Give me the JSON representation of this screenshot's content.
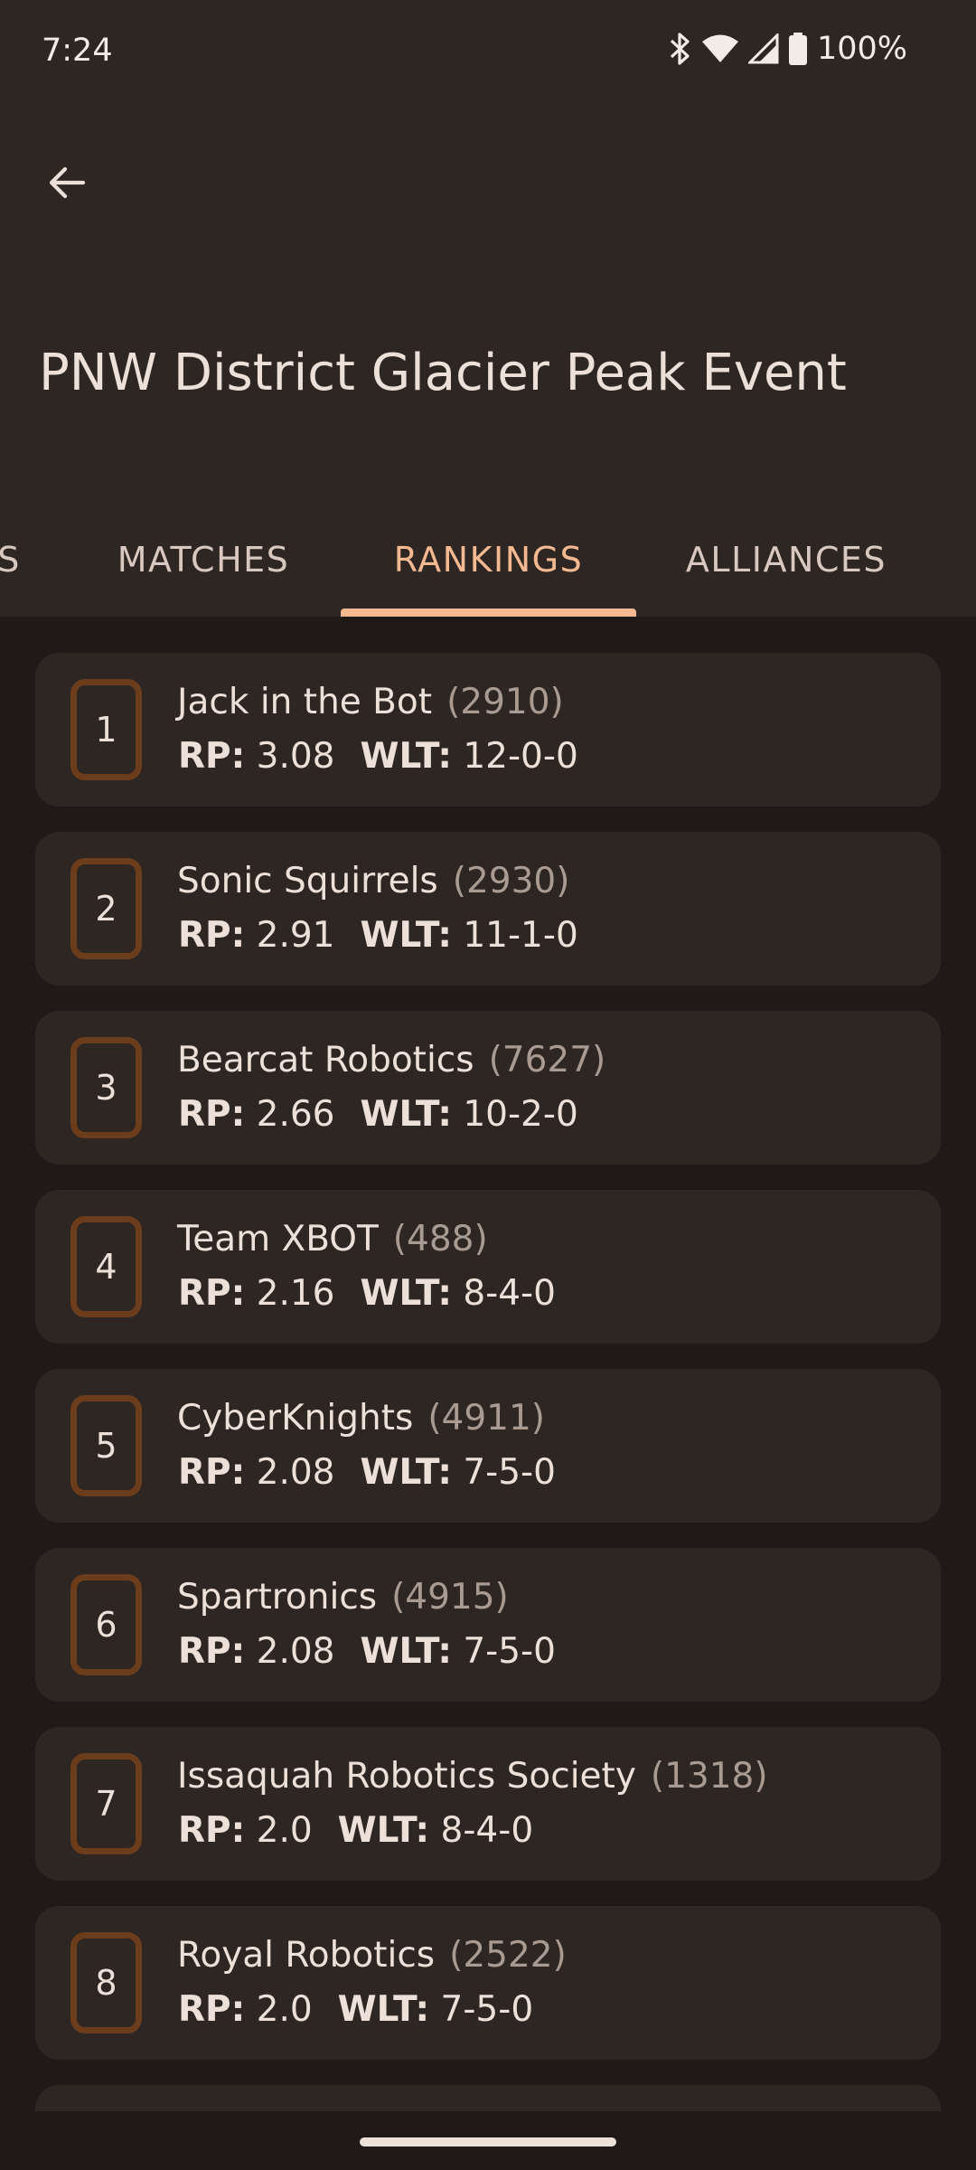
{
  "status_bar": {
    "time": "7:24",
    "battery": "100%"
  },
  "header": {
    "title": "PNW District Glacier Peak Event"
  },
  "tabs": [
    {
      "label": "S",
      "active": false
    },
    {
      "label": "MATCHES",
      "active": false
    },
    {
      "label": "RANKINGS",
      "active": true
    },
    {
      "label": "ALLIANCES",
      "active": false
    }
  ],
  "labels": {
    "rp": "RP:",
    "wlt": "WLT:"
  },
  "rankings": [
    {
      "rank": "1",
      "name": "Jack in the Bot",
      "number": "(2910)",
      "rp": "3.08",
      "wlt": "12-0-0"
    },
    {
      "rank": "2",
      "name": "Sonic Squirrels",
      "number": "(2930)",
      "rp": "2.91",
      "wlt": "11-1-0"
    },
    {
      "rank": "3",
      "name": "Bearcat Robotics",
      "number": "(7627)",
      "rp": "2.66",
      "wlt": "10-2-0"
    },
    {
      "rank": "4",
      "name": "Team XBOT",
      "number": "(488)",
      "rp": "2.16",
      "wlt": "8-4-0"
    },
    {
      "rank": "5",
      "name": "CyberKnights",
      "number": "(4911)",
      "rp": "2.08",
      "wlt": "7-5-0"
    },
    {
      "rank": "6",
      "name": "Spartronics",
      "number": "(4915)",
      "rp": "2.08",
      "wlt": "7-5-0"
    },
    {
      "rank": "7",
      "name": "Issaquah Robotics Society",
      "number": "(1318)",
      "rp": "2.0",
      "wlt": "8-4-0"
    },
    {
      "rank": "8",
      "name": "Royal Robotics",
      "number": "(2522)",
      "rp": "2.0",
      "wlt": "7-5-0"
    }
  ],
  "colors": {
    "background": "#1f1a17",
    "surface": "#2e2622",
    "accent": "#f4b990",
    "rank_border": "#6b3d1c"
  }
}
